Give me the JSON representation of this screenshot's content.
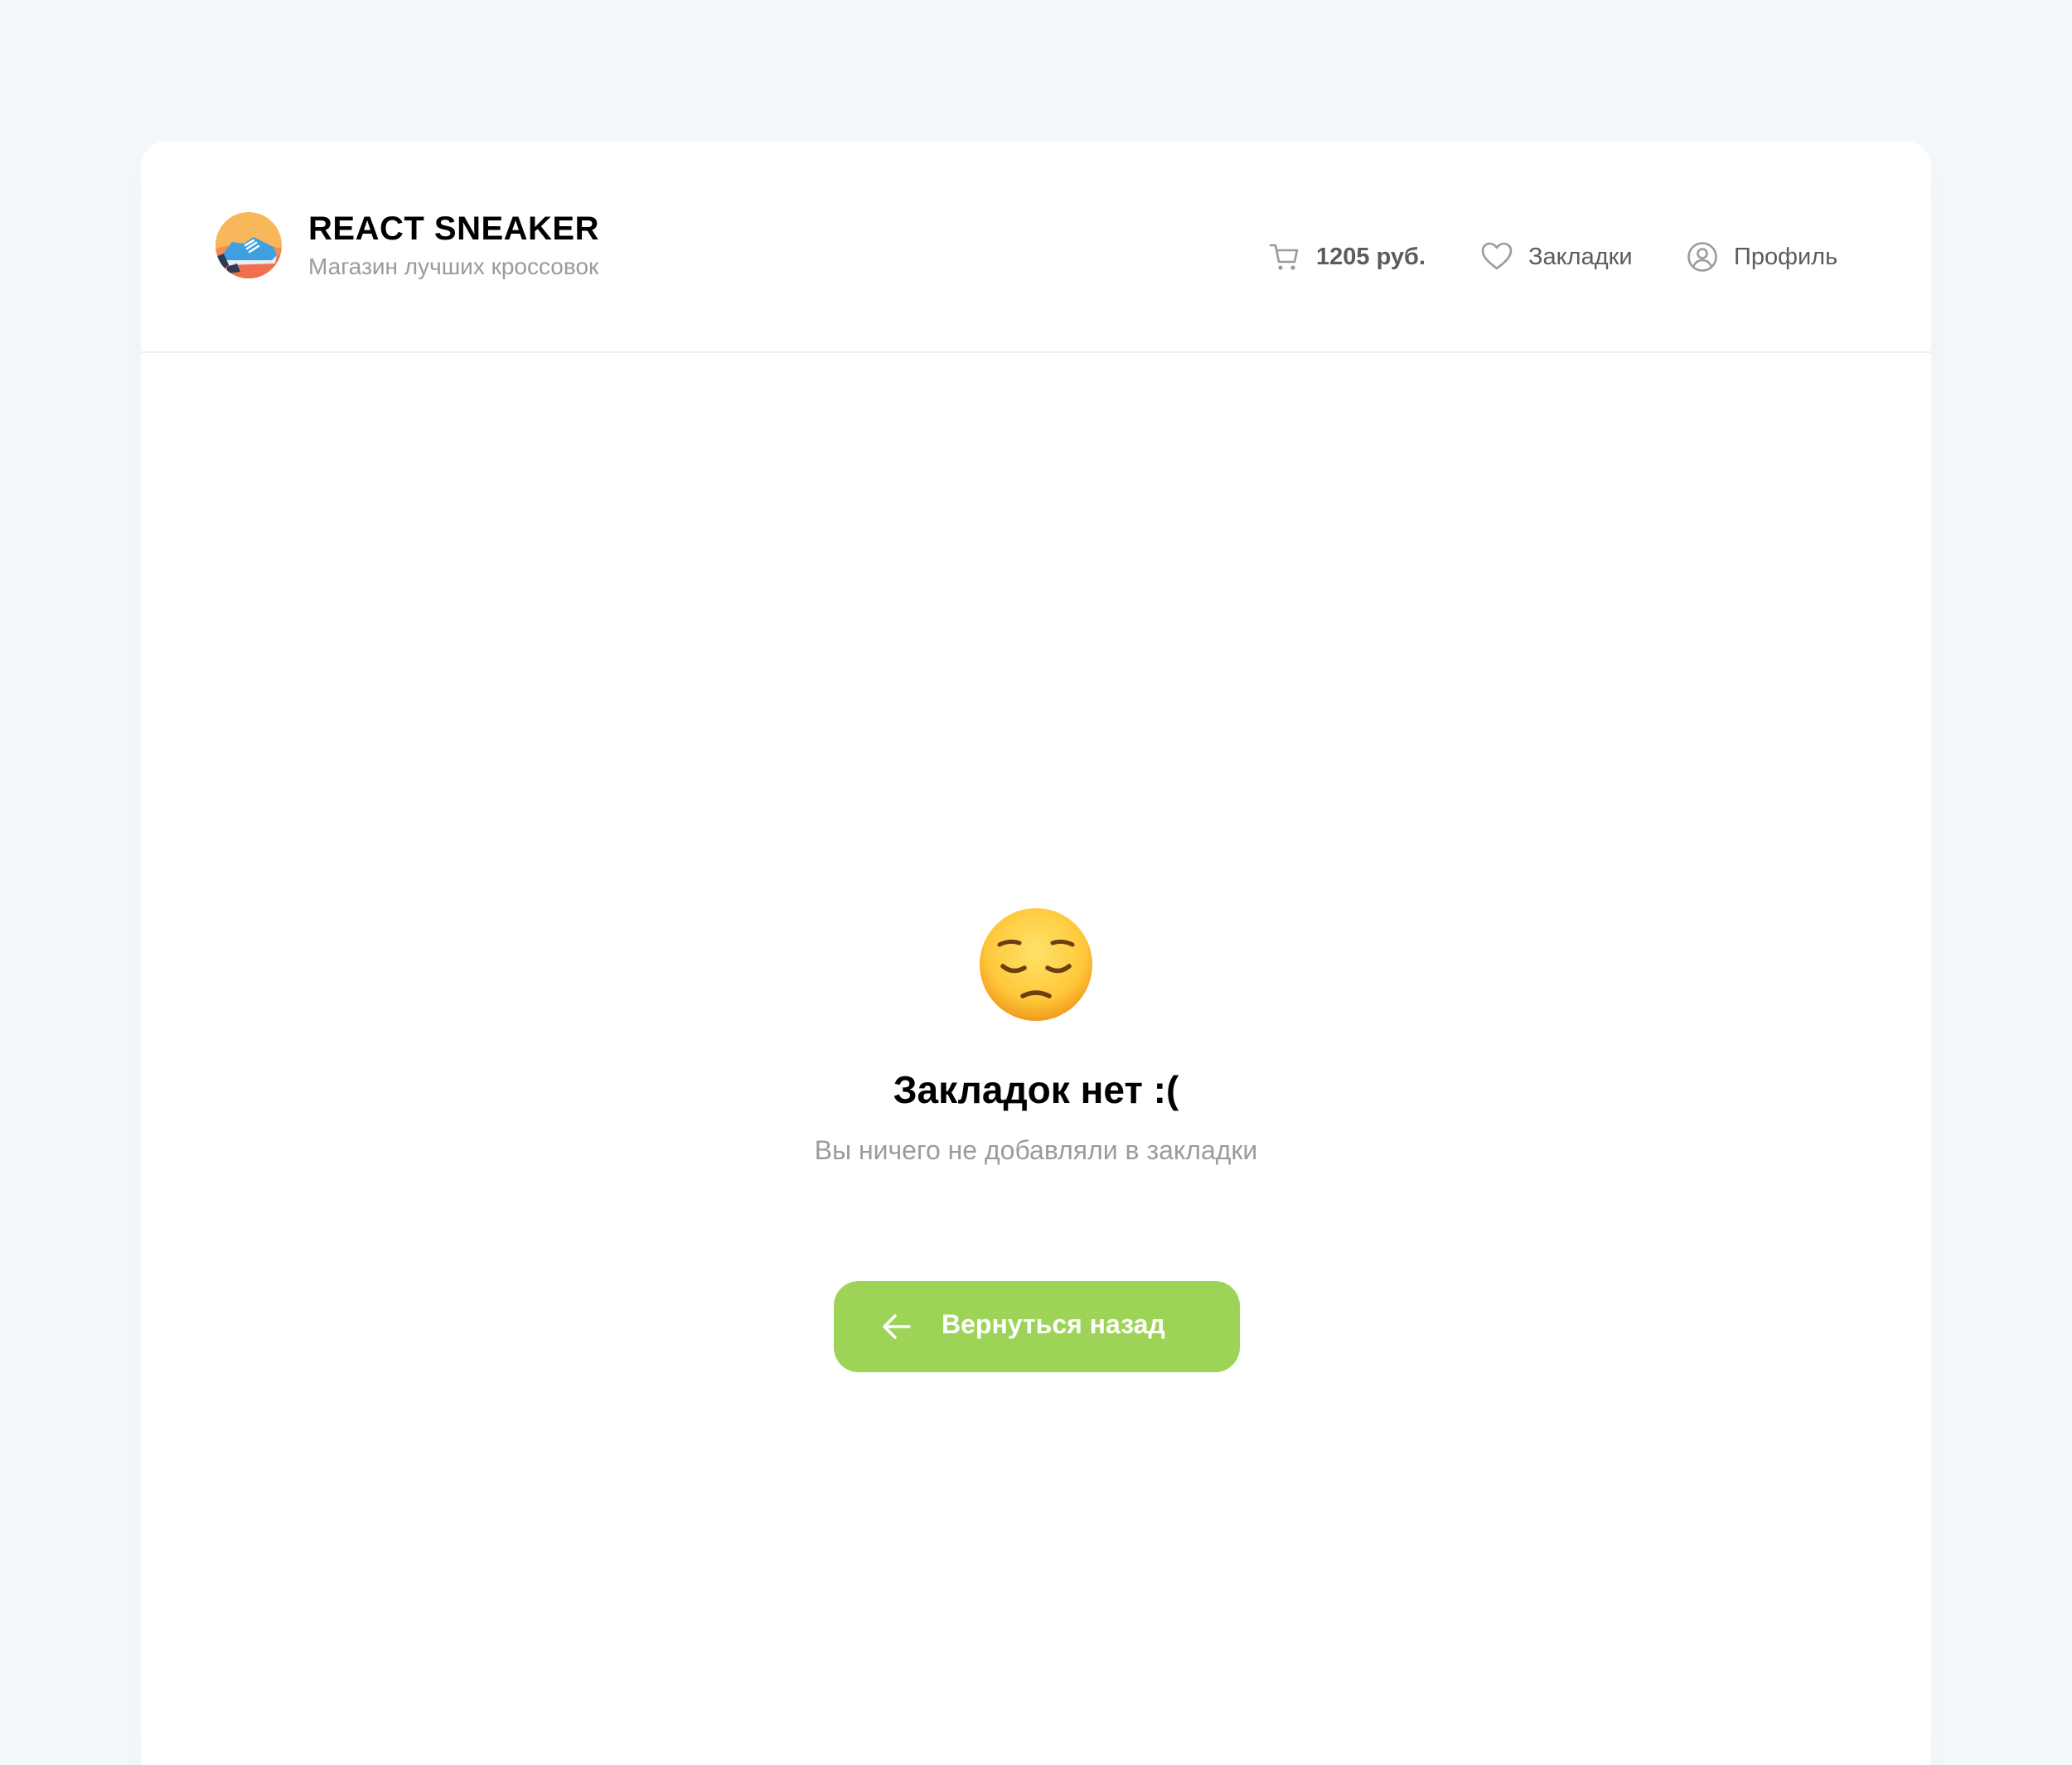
{
  "header": {
    "brand_title": "REACT SNEAKER",
    "brand_subtitle": "Магазин лучших кроссовок",
    "cart_total": "1205 руб.",
    "bookmarks_label": "Закладки",
    "profile_label": "Профиль"
  },
  "empty_state": {
    "emoji": "pensive-face",
    "title": "Закладок нет :(",
    "subtitle": "Вы ничего не добавляли в закладки",
    "button_label": "Вернуться назад"
  },
  "colors": {
    "page_bg": "#F6F9FC",
    "card_bg": "#FFFFFF",
    "accent_green": "#9DD458",
    "muted_text": "#9B9B9B"
  }
}
